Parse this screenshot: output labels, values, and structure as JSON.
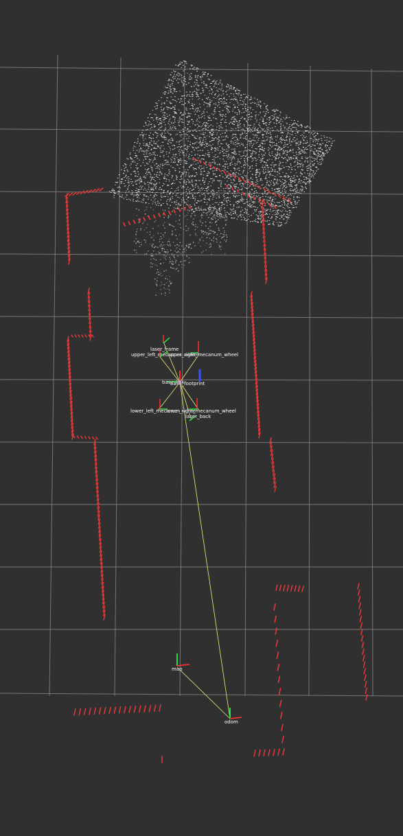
{
  "scene": {
    "view": "3D visualization viewport",
    "colors": {
      "background": "#303030",
      "grid": "#8f8f8f",
      "laser_scan": "#e83a3a",
      "point_cloud": "#f2f2f2",
      "tf_link": "#f3f17a",
      "axis_x": "#ff2d2d",
      "axis_y": "#22ee44",
      "axis_z": "#3355ff"
    }
  },
  "tf_frames": {
    "laser_frame": "laser_frame",
    "upper_left_wheel": "upper_left_mecanum_wheel",
    "upper_right_wheel": "upper_right_mecanum_wheel",
    "base_link": "base_link",
    "base_footprint": "base_footprint",
    "lower_left_wheel": "lower_left_mecanum_wheel",
    "lower_right_wheel": "lower_right_mecanum_wheel",
    "laser_back": "laser_back",
    "map": "map",
    "odom": "odom"
  }
}
